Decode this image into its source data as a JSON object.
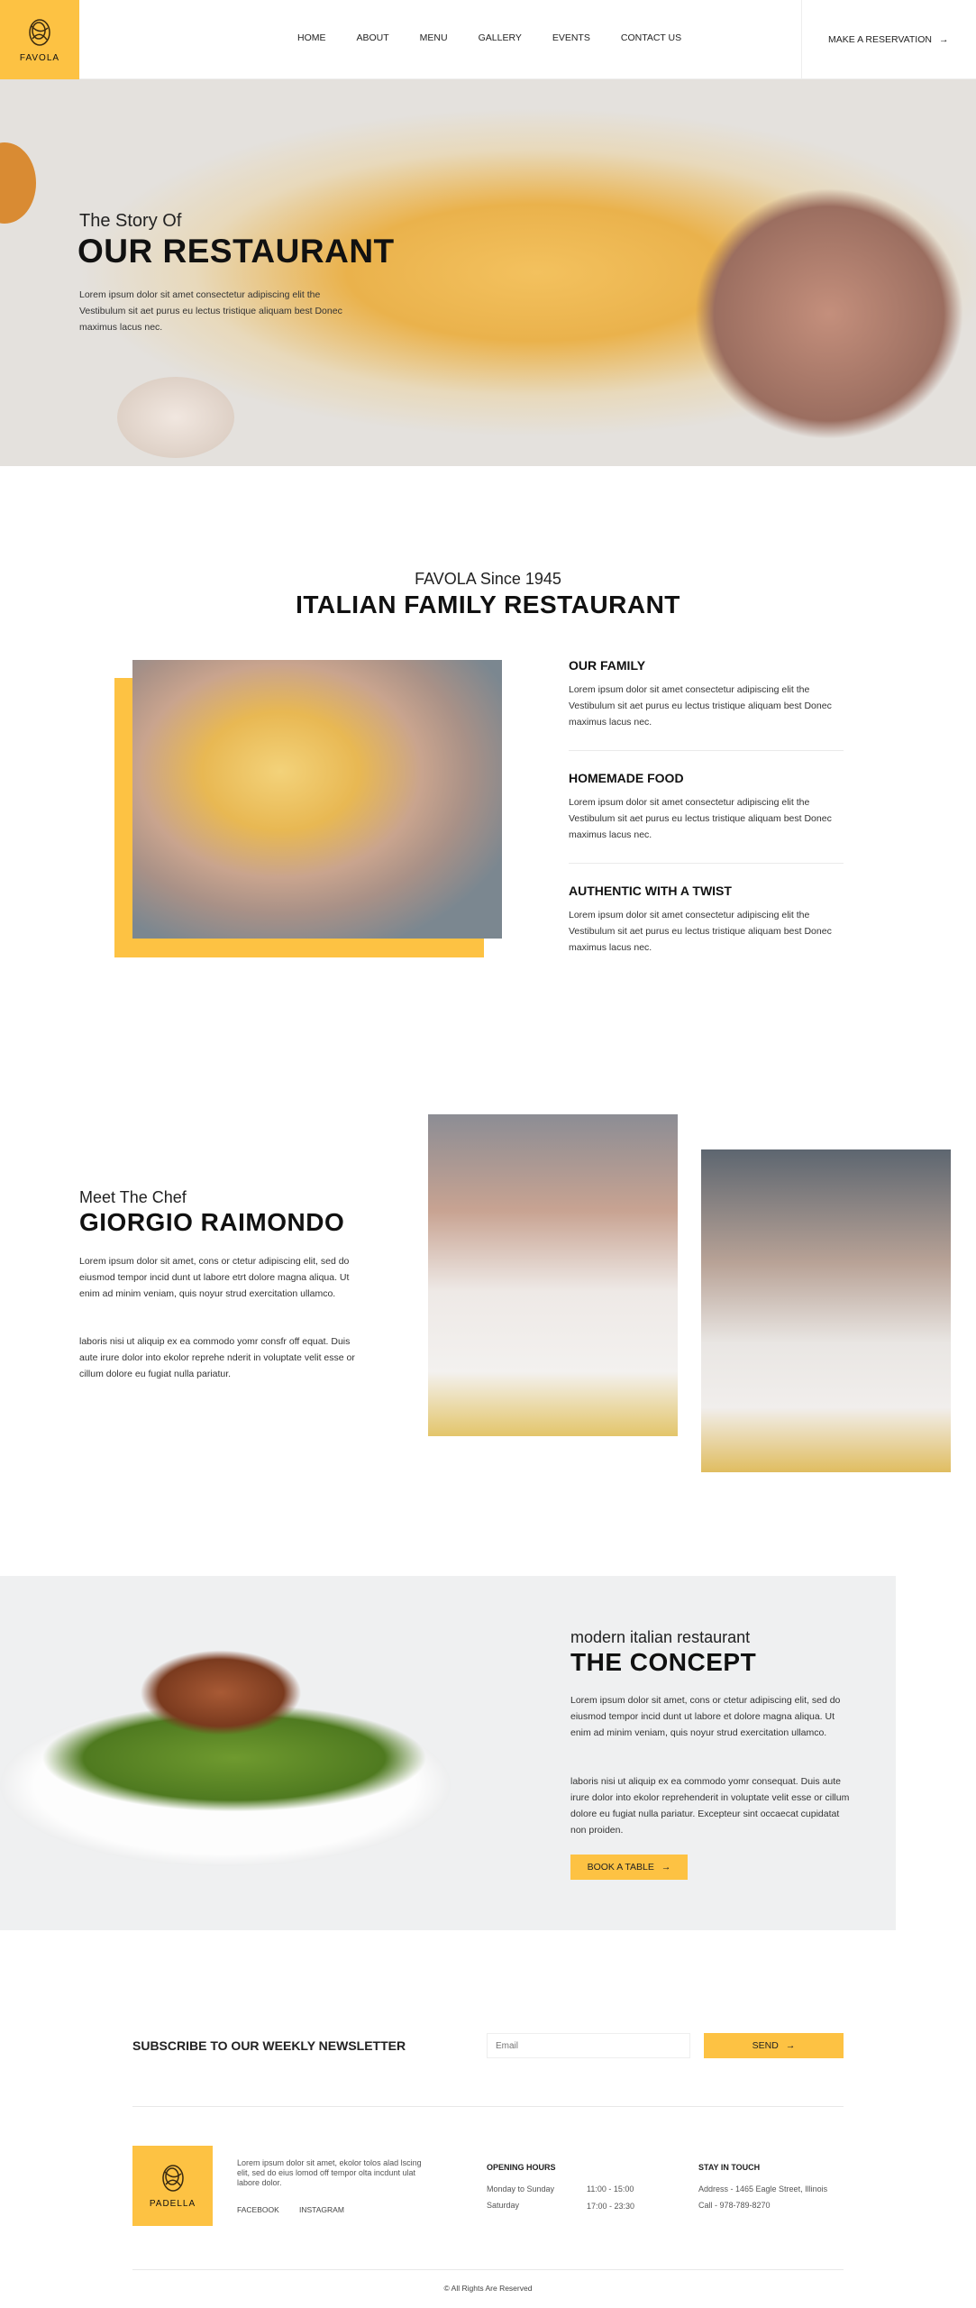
{
  "colors": {
    "accent": "#FDC243",
    "text": "#111111",
    "concept_bg": "#EFF0F1"
  },
  "nav": {
    "logo": "FAVOLA",
    "links": [
      "HOME",
      "ABOUT",
      "MENU",
      "GALLERY",
      "EVENTS",
      "CONTACT US"
    ],
    "reservation": "MAKE A RESERVATION",
    "reservation_icon": "arrow-right-icon"
  },
  "hero": {
    "subtitle": "The Story Of",
    "title": "OUR RESTAURANT",
    "text": "Lorem ipsum dolor sit amet consectetur adipiscing elit the Vestibulum sit aet purus eu lectus tristique aliquam best Donec maximus lacus nec."
  },
  "about": {
    "subtitle": "FAVOLA Since 1945",
    "title": "ITALIAN FAMILY RESTAURANT",
    "items": [
      {
        "title": "OUR FAMILY",
        "text": "Lorem ipsum dolor sit amet consectetur adipiscing elit the Vestibulum sit aet purus eu lectus tristique aliquam best Donec maximus lacus nec."
      },
      {
        "title": "HOMEMADE FOOD",
        "text": "Lorem ipsum dolor sit amet consectetur adipiscing elit the Vestibulum sit aet purus eu lectus tristique aliquam best Donec maximus lacus nec."
      },
      {
        "title": "AUTHENTIC WITH A TWIST",
        "text": "Lorem ipsum dolor sit amet consectetur adipiscing elit the Vestibulum sit aet purus eu lectus tristique aliquam best Donec maximus lacus nec."
      }
    ]
  },
  "chef": {
    "subtitle": "Meet The Chef",
    "title": "GIORGIO RAIMONDO",
    "p1": "Lorem ipsum dolor sit amet, cons or ctetur adipiscing elit, sed do eiusmod tempor incid dunt ut labore etrt dolore magna aliqua. Ut enim ad minim veniam, quis noyur strud exercitation ullamco.",
    "p2": "laboris nisi ut aliquip ex ea commodo yomr consfr off equat. Duis aute irure dolor into ekolor reprehe nderit in voluptate velit esse or cillum dolore eu fugiat nulla pariatur."
  },
  "concept": {
    "subtitle": "modern italian restaurant",
    "title": "THE CONCEPT",
    "p1": "Lorem ipsum dolor sit amet, cons or ctetur adipiscing elit, sed do eiusmod tempor incid dunt ut labore et dolore magna aliqua. Ut enim ad minim veniam, quis noyur strud exercitation ullamco.",
    "p2": "laboris nisi ut aliquip ex ea commodo yomr consequat. Duis aute irure dolor into ekolor reprehenderit in voluptate velit esse or cillum dolore eu fugiat nulla pariatur. Excepteur sint occaecat cupidatat non proiden.",
    "button": "BOOK A TABLE"
  },
  "newsletter": {
    "title": "SUBSCRIBE TO OUR WEEKLY NEWSLETTER",
    "placeholder": "Email",
    "button": "SEND"
  },
  "footer": {
    "logo": "PADELLA",
    "text": "Lorem ipsum dolor sit amet, ekolor tolos alad lscing elit, sed do eius lomod off tempor olta incdunt ulat labore dolor.",
    "social": [
      "FACEBOOK",
      "INSTAGRAM"
    ],
    "hours": {
      "title": "OPENING HOURS",
      "rows": [
        {
          "day": "Monday to Sunday",
          "time": "11:00 - 15:00"
        },
        {
          "day": "Saturday",
          "time": "17:00 - 23:30"
        }
      ]
    },
    "contact": {
      "title": "STAY IN TOUCH",
      "address": "Address - 1465  Eagle Street, Illinois",
      "phone": "Call - 978-789-8270"
    },
    "copyright": "© All Rights Are Reserved"
  }
}
